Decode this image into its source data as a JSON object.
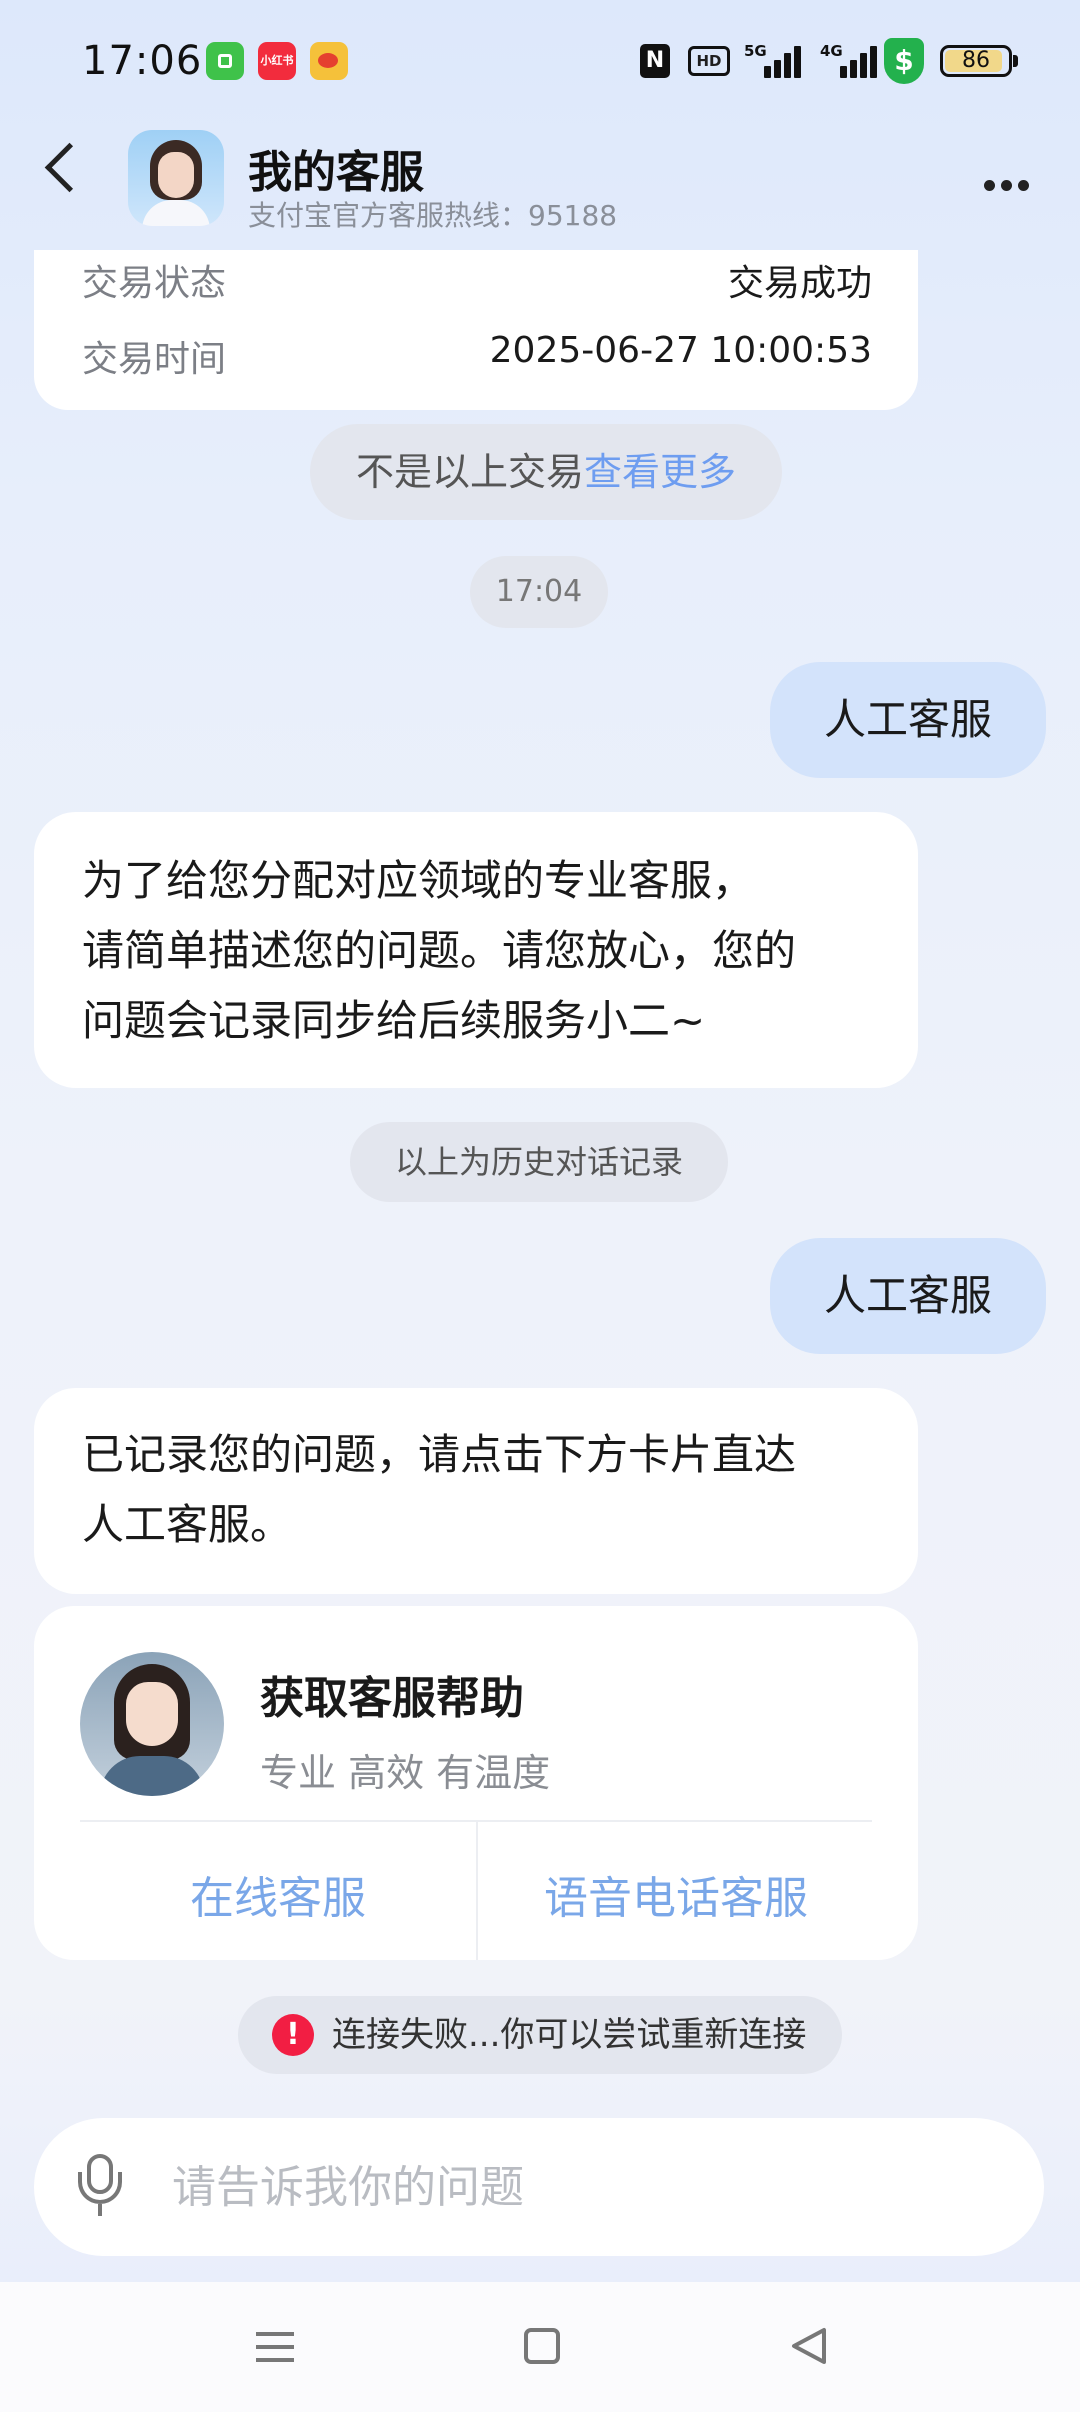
{
  "status_bar": {
    "time": "17:06",
    "app_icons": [
      "app-store-icon",
      "xiaohongshu-icon",
      "weibo-icon"
    ],
    "red_icon_text": "小红书",
    "nfc_label": "N",
    "hd_label": "HD",
    "signal1_label": "5G",
    "signal2_label": "4G",
    "shield_label": "$",
    "battery": "86"
  },
  "header": {
    "title": "我的客服",
    "subtitle": "支付宝官方客服热线：95188"
  },
  "transaction": {
    "status_label": "交易状态",
    "status_value": "交易成功",
    "time_label": "交易时间",
    "time_value": "2025-06-27 10:00:53"
  },
  "not_above": {
    "prefix": "不是以上交易",
    "link": "查看更多"
  },
  "timestamp": "17:04",
  "messages": {
    "user1": "人工客服",
    "bot1_line1": "为了给您分配对应领域的专业客服，",
    "bot1_line2": "请简单描述您的问题。请您放心，您的",
    "bot1_line3": "问题会记录同步给后续服务小二~",
    "history_note": "以上为历史对话记录",
    "user2": "人工客服",
    "bot2_line1": "已记录您的问题，请点击下方卡片直达",
    "bot2_line2": "人工客服。"
  },
  "help_card": {
    "title": "获取客服帮助",
    "subtitle": "专业 高效 有温度",
    "online_button": "在线客服",
    "phone_button": "语音电话客服"
  },
  "error": {
    "icon": "!",
    "text": "连接失败...你可以尝试重新连接"
  },
  "input": {
    "placeholder": "请告诉我你的问题"
  },
  "colors": {
    "link": "#6e9df0",
    "user_bubble": "#d3e3fb",
    "error_red": "#f21e43"
  }
}
